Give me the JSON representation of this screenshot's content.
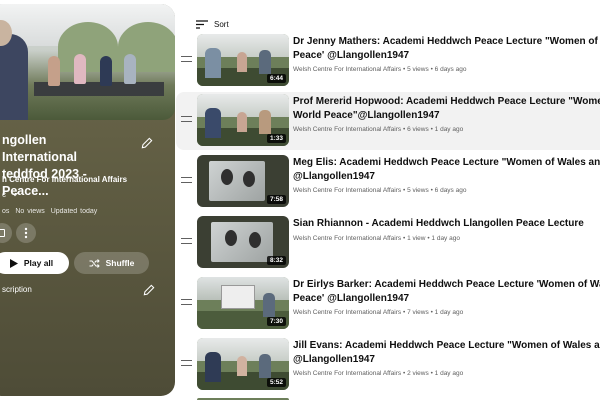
{
  "playlist": {
    "title_line1": "ngollen International",
    "title_line2": "teddfod 2023 - Peace...",
    "channel": "h Centre For International Affairs",
    "visibility": "c",
    "stats": {
      "videos": "os",
      "views": "No views",
      "updated": "Updated today"
    },
    "play_label": "Play all",
    "shuffle_label": "Shuffle",
    "description_label": "scription"
  },
  "sort": {
    "label": "Sort"
  },
  "videos": [
    {
      "title1": "Dr Jenny Mathers: Academi Heddwch Peace Lecture \"Women of Wales and World",
      "title2": "Peace' @Llangollen1947",
      "channel": "Welsh Centre For International Affairs",
      "views": "5 views",
      "age": "6 days ago",
      "duration": "6:44"
    },
    {
      "title1": "Prof Mererid Hopwood: Academi Heddwch Peace Lecture \"Women of Wales and",
      "title2": "World Peace\"@Llangollen1947",
      "channel": "Welsh Centre For International Affairs",
      "views": "6 views",
      "age": "1 day ago",
      "duration": "1:33"
    },
    {
      "title1": "Meg Elis: Academi Heddwch Peace Lecture \"Women of Wales and World Peace\"",
      "title2": "@Llangollen1947",
      "channel": "Welsh Centre For International Affairs",
      "views": "5 views",
      "age": "6 days ago",
      "duration": "7:58"
    },
    {
      "title1": "Sian Rhiannon - Academi Heddwch Llangollen Peace Lecture",
      "title2": "",
      "channel": "Welsh Centre For International Affairs",
      "views": "1 view",
      "age": "1 day ago",
      "duration": "8:32"
    },
    {
      "title1": "Dr Eirlys Barker: Academi Heddwch Peace Lecture 'Women of Wales and World",
      "title2": "Peace' @Llangollen1947",
      "channel": "Welsh Centre For International Affairs",
      "views": "7 views",
      "age": "1 day ago",
      "duration": "7:30"
    },
    {
      "title1": "Jill Evans: Academi Heddwch Peace Lecture \"Women of Wales and World Peace\"",
      "title2": "@Llangollen1947",
      "channel": "Welsh Centre For International Affairs",
      "views": "2 views",
      "age": "1 day ago",
      "duration": "5:52"
    }
  ],
  "separator": "•",
  "icons": {
    "edit": "pencil-icon",
    "more": "more-vert-icon",
    "play": "play-icon",
    "shuffle": "shuffle-icon",
    "sort": "sort-icon",
    "drag": "drag-handle-icon"
  },
  "colors": {
    "panel": "#5f5c42",
    "active_row": "#f2f2f2",
    "meta": "#606060"
  }
}
